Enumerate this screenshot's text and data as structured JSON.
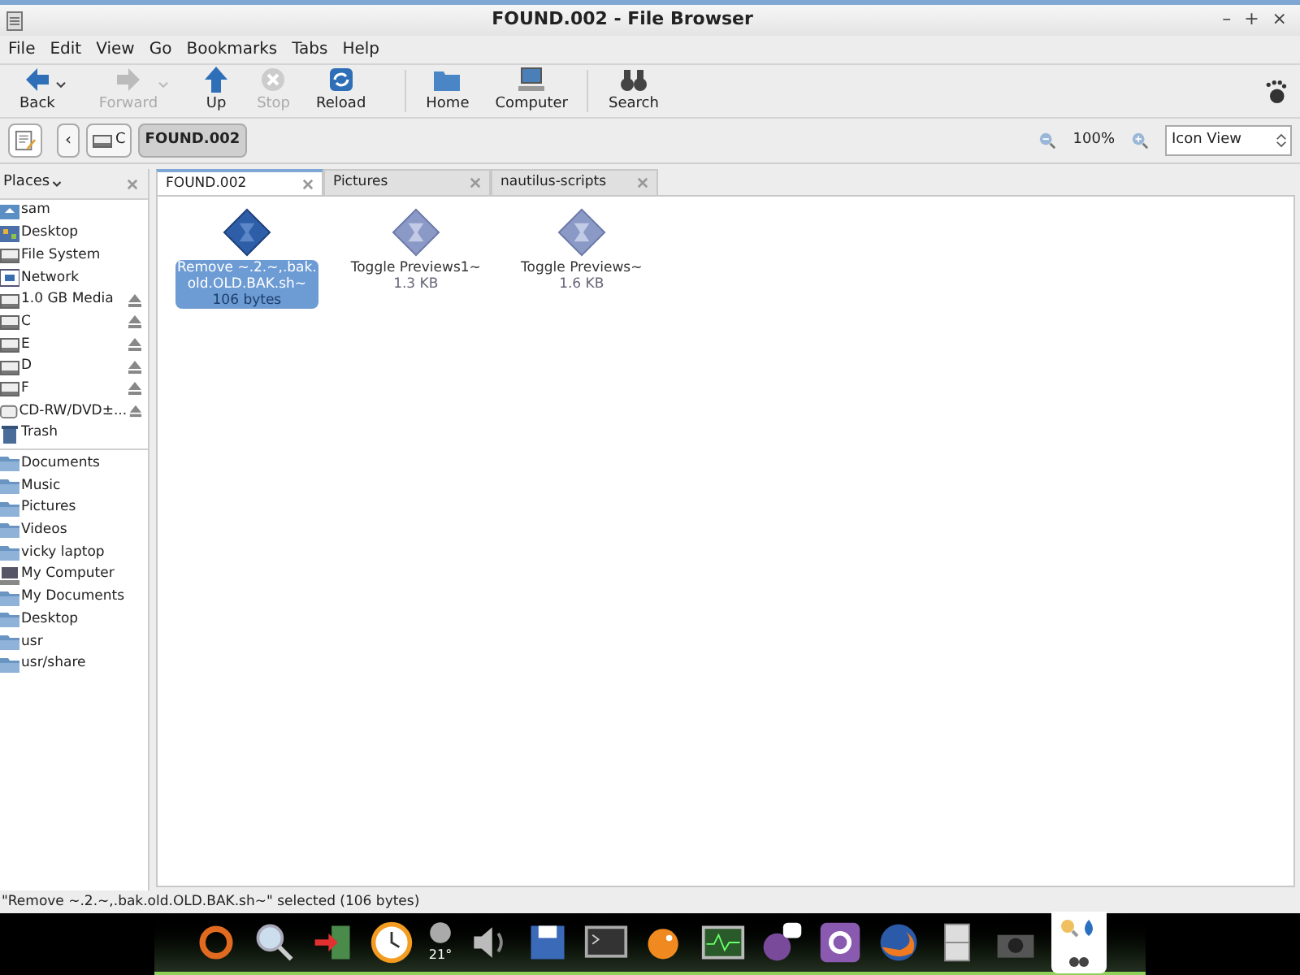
{
  "window": {
    "title": "FOUND.002 - File Browser",
    "controls": [
      "–",
      "+",
      "×"
    ]
  },
  "menu": [
    "File",
    "Edit",
    "View",
    "Go",
    "Bookmarks",
    "Tabs",
    "Help"
  ],
  "toolbar": [
    {
      "label": "Back",
      "kind": "back",
      "disabled": false,
      "dropdown": true
    },
    {
      "label": "Forward",
      "kind": "forward",
      "disabled": true,
      "dropdown": true
    },
    {
      "label": "Up",
      "kind": "up",
      "disabled": false,
      "dropdown": false
    },
    {
      "label": "Stop",
      "kind": "stop",
      "disabled": true,
      "dropdown": false
    },
    {
      "label": "Reload",
      "kind": "reload",
      "disabled": false,
      "dropdown": false
    },
    {
      "label": "Home",
      "kind": "home",
      "disabled": false,
      "dropdown": false
    },
    {
      "label": "Computer",
      "kind": "computer",
      "disabled": false,
      "dropdown": false
    },
    {
      "label": "Search",
      "kind": "search",
      "disabled": false,
      "dropdown": false
    }
  ],
  "location": {
    "back": "‹",
    "crumbs": [
      {
        "label": "C",
        "drive": true,
        "selected": false
      },
      {
        "label": "FOUND.002",
        "drive": false,
        "selected": true
      }
    ],
    "zoom": "100%",
    "view": "Icon View"
  },
  "sidebar": {
    "title": "Places",
    "items": [
      {
        "label": "sam",
        "kind": "home",
        "eject": false
      },
      {
        "label": "Desktop",
        "kind": "desktop",
        "eject": false
      },
      {
        "label": "File System",
        "kind": "drive",
        "eject": false
      },
      {
        "label": "Network",
        "kind": "network",
        "eject": false
      },
      {
        "label": "1.0 GB Media",
        "kind": "drive",
        "eject": true
      },
      {
        "label": "C",
        "kind": "drive",
        "eject": true
      },
      {
        "label": "E",
        "kind": "drive",
        "eject": true
      },
      {
        "label": "D",
        "kind": "drive",
        "eject": true
      },
      {
        "label": "F",
        "kind": "drive",
        "eject": true
      },
      {
        "label": "CD-RW/DVD±...",
        "kind": "disc",
        "eject": true
      },
      {
        "label": "Trash",
        "kind": "trash",
        "eject": false
      }
    ],
    "bookmarks": [
      {
        "label": "Documents",
        "kind": "folder"
      },
      {
        "label": "Music",
        "kind": "folder"
      },
      {
        "label": "Pictures",
        "kind": "folder"
      },
      {
        "label": "Videos",
        "kind": "folder"
      },
      {
        "label": "vicky laptop",
        "kind": "folder"
      },
      {
        "label": "My Computer",
        "kind": "computer"
      },
      {
        "label": "My Documents",
        "kind": "folder"
      },
      {
        "label": "Desktop",
        "kind": "folder"
      },
      {
        "label": "usr",
        "kind": "folder"
      },
      {
        "label": "usr/share",
        "kind": "folder"
      }
    ]
  },
  "tabs": [
    {
      "label": "FOUND.002",
      "selected": true
    },
    {
      "label": "Pictures",
      "selected": false
    },
    {
      "label": "nautilus-scripts",
      "selected": false
    }
  ],
  "files": [
    {
      "name": "Remove ~.2.~,.bak.\nold.OLD.BAK.sh~",
      "size": "106 bytes",
      "selected": true
    },
    {
      "name": "Toggle Previews1~",
      "size": "1.3 KB",
      "selected": false
    },
    {
      "name": "Toggle Previews~",
      "size": "1.6 KB",
      "selected": false
    }
  ],
  "status_bar": "\"Remove ~.2.~,.bak.old.OLD.BAK.sh~\" selected (106 bytes)",
  "dock": {
    "weather_reading": "21°"
  }
}
